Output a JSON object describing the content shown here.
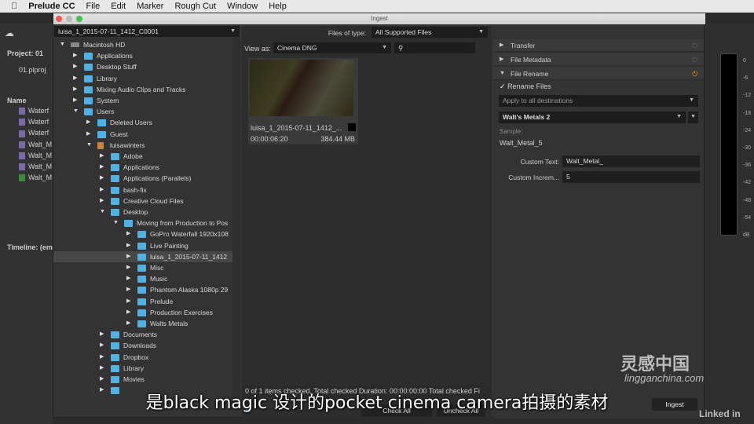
{
  "menubar": {
    "app": "Prelude CC",
    "items": [
      "File",
      "Edit",
      "Marker",
      "Rough Cut",
      "Window",
      "Help"
    ]
  },
  "background": {
    "project_label": "Project: 01",
    "project_file": "01.plproj",
    "name_header": "Name",
    "clips": [
      "Waterf",
      "Waterf",
      "Waterf",
      "Walt_M",
      "Walt_M",
      "Walt_M",
      "Walt_M"
    ],
    "timeline_label": "Timeline: (em",
    "meter_ticks": [
      "0",
      "-6",
      "-12",
      "-18",
      "-24",
      "-30",
      "-36",
      "-42",
      "-48",
      "-54",
      "dB"
    ]
  },
  "dialog": {
    "title": "Ingest",
    "source_dropdown": "luisa_1_2015-07-11_1412_C0001",
    "tree": [
      {
        "label": "Macintosh HD",
        "depth": 0,
        "expanded": true,
        "icon": "drive-icon"
      },
      {
        "label": "Applications",
        "depth": 1
      },
      {
        "label": "Desktop Stuff",
        "depth": 1
      },
      {
        "label": "Library",
        "depth": 1
      },
      {
        "label": "Mixing Audio Clips and Tracks",
        "depth": 1
      },
      {
        "label": "System",
        "depth": 1
      },
      {
        "label": "Users",
        "depth": 1,
        "expanded": true
      },
      {
        "label": "Deleted Users",
        "depth": 2
      },
      {
        "label": "Guest",
        "depth": 2
      },
      {
        "label": "luisawinters",
        "depth": 2,
        "expanded": true,
        "icon": "home-icon"
      },
      {
        "label": "Adobe",
        "depth": 3
      },
      {
        "label": "Applications",
        "depth": 3
      },
      {
        "label": "Applications (Parallels)",
        "depth": 3
      },
      {
        "label": "bash-fix",
        "depth": 3
      },
      {
        "label": "Creative Cloud Files",
        "depth": 3
      },
      {
        "label": "Desktop",
        "depth": 3,
        "expanded": true
      },
      {
        "label": "Moving from Production to Pos",
        "depth": 4,
        "expanded": true
      },
      {
        "label": "GoPro Waterfall 1920x108",
        "depth": 5
      },
      {
        "label": "Live Painting",
        "depth": 5
      },
      {
        "label": "luisa_1_2015-07-11_1412",
        "depth": 5,
        "selected": true
      },
      {
        "label": "Misc",
        "depth": 5
      },
      {
        "label": "Music",
        "depth": 5
      },
      {
        "label": "Phantom Alaska 1080p 29",
        "depth": 5
      },
      {
        "label": "Prelude",
        "depth": 5
      },
      {
        "label": "Production Exercises",
        "depth": 5
      },
      {
        "label": "Walts Metals",
        "depth": 5
      },
      {
        "label": "Documents",
        "depth": 3
      },
      {
        "label": "Downloads",
        "depth": 3
      },
      {
        "label": "Dropbox",
        "depth": 3
      },
      {
        "label": "Library",
        "depth": 3
      },
      {
        "label": "Movies",
        "depth": 3
      },
      {
        "label": "",
        "depth": 3
      }
    ],
    "files_of_type_label": "Files of type:",
    "files_of_type": "All Supported Files",
    "view_as_label": "View as:",
    "view_as": "Cinema DNG",
    "search_placeholder": "",
    "clip": {
      "name": "luisa_1_2015-07-11_1412_...",
      "duration": "00:00:06:20",
      "size": "384.44 MB"
    },
    "status": "0 of 1 items checked,  Total checked Duration: 00:00:00:00   Total checked Fi",
    "check_all": "Check All",
    "uncheck_all": "Uncheck All",
    "ingest": "Ingest",
    "sections": {
      "transfer": "Transfer",
      "file_metadata": "File Metadata",
      "file_rename": "File Rename"
    },
    "rename": {
      "checkbox": "Rename Files",
      "checked": true,
      "apply": "Apply to all destinations",
      "preset": "Walt's Metals 2",
      "sample_label": "Sample:",
      "sample": "Walt_Metal_5",
      "custom_text_label": "Custom Text:",
      "custom_text": "Walt_Metal_",
      "custom_incr_label": "Custom Increm...",
      "custom_incr": "5"
    }
  },
  "subtitle": "是black magic 设计的pocket cinema camera拍摄的素材",
  "watermark": {
    "site": "lingganchina.com",
    "brand": "灵感中国",
    "linkedin": "Linked in"
  },
  "colors": {
    "folder": "#4fb2e6",
    "power_active": "#e0a020"
  }
}
